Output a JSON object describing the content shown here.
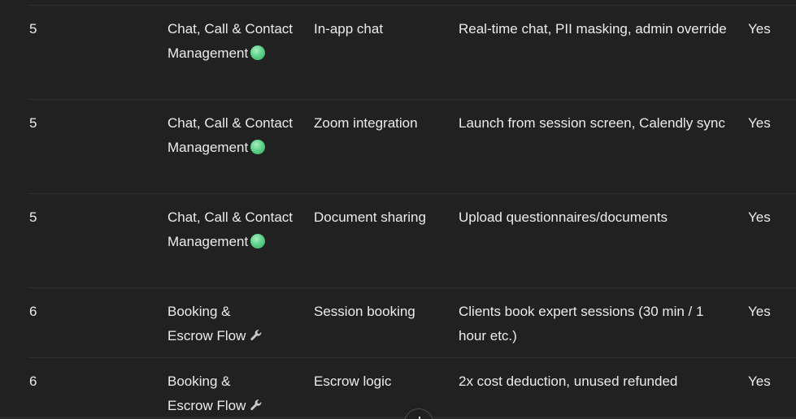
{
  "rows": [
    {
      "phase": "5",
      "category": "Chat, Call & Contact Management",
      "category_icon": "green-circle-icon",
      "feature": "In-app chat",
      "description": "Real-time chat, PII masking, admin override",
      "included": "Yes"
    },
    {
      "phase": "5",
      "category": "Chat, Call & Contact Management",
      "category_icon": "green-circle-icon",
      "feature": "Zoom integration",
      "description": "Launch from session screen, Calendly sync",
      "included": "Yes"
    },
    {
      "phase": "5",
      "category": "Chat, Call & Contact Management",
      "category_icon": "green-circle-icon",
      "feature": "Document sharing",
      "description": "Upload questionnaires/documents",
      "included": "Yes"
    },
    {
      "phase": "6",
      "category": "Booking & Escrow Flow",
      "category_icon": "wrench-icon",
      "feature": "Session booking",
      "description": "Clients book expert sessions (30 min / 1 hour etc.)",
      "included": "Yes"
    },
    {
      "phase": "6",
      "category": "Booking & Escrow Flow",
      "category_icon": "wrench-icon",
      "feature": "Escrow logic",
      "description": "2x cost deduction, unused refunded",
      "included": "Yes"
    }
  ],
  "colors": {
    "background": "#212121",
    "text": "#ececec",
    "divider": "#2f2f2f",
    "green_dot": "#5fd38a"
  },
  "scroll_button_icon": "arrow-down-icon"
}
